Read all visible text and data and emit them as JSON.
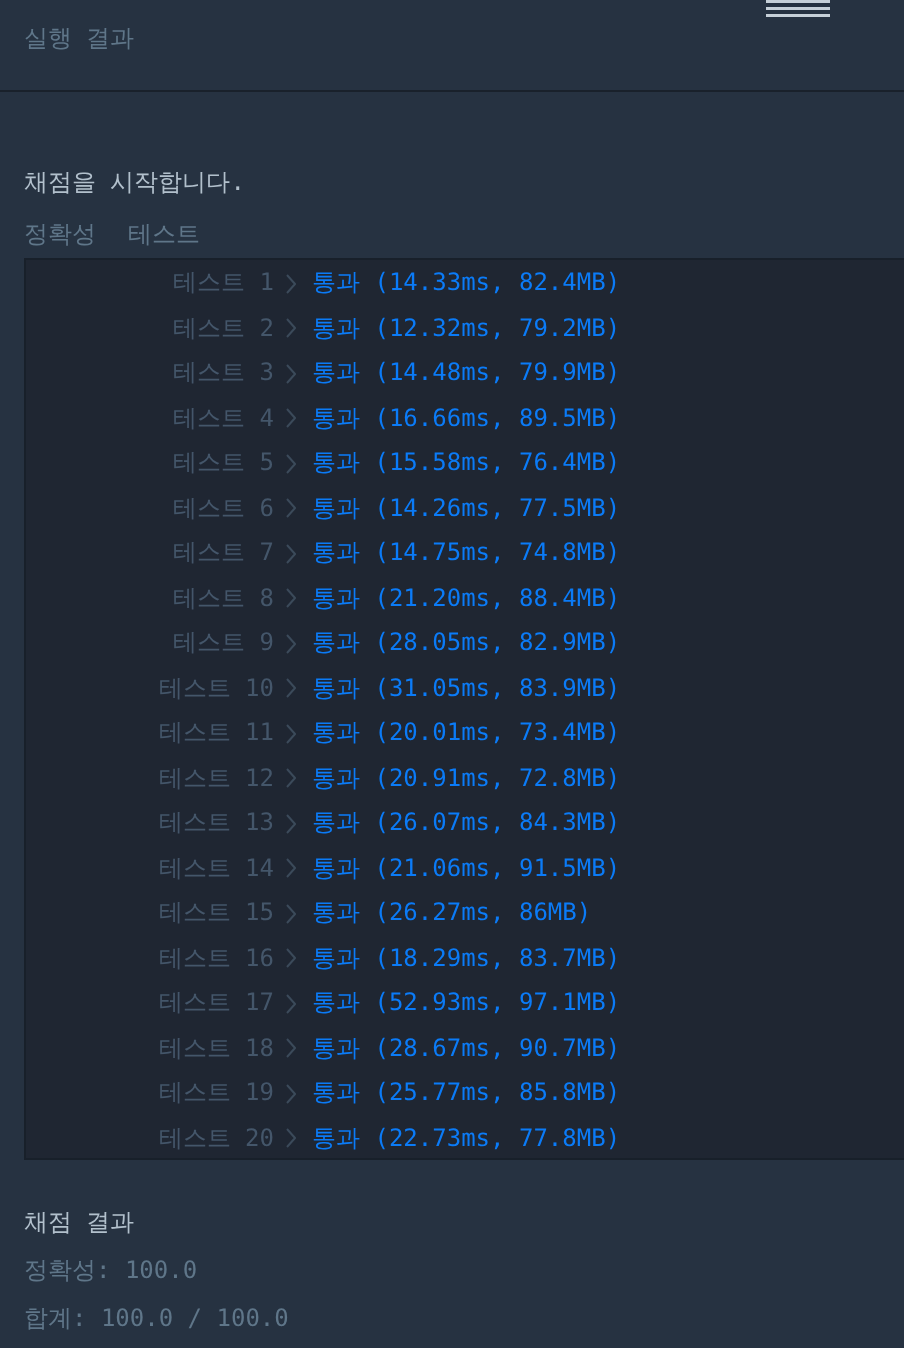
{
  "header": {
    "title": "실행 결과"
  },
  "intro": "채점을 시작합니다.",
  "tabs": [
    "정확성",
    "테스트"
  ],
  "tests": [
    {
      "label": "테스트 1",
      "result": "통과 (14.33ms, 82.4MB)"
    },
    {
      "label": "테스트 2",
      "result": "통과 (12.32ms, 79.2MB)"
    },
    {
      "label": "테스트 3",
      "result": "통과 (14.48ms, 79.9MB)"
    },
    {
      "label": "테스트 4",
      "result": "통과 (16.66ms, 89.5MB)"
    },
    {
      "label": "테스트 5",
      "result": "통과 (15.58ms, 76.4MB)"
    },
    {
      "label": "테스트 6",
      "result": "통과 (14.26ms, 77.5MB)"
    },
    {
      "label": "테스트 7",
      "result": "통과 (14.75ms, 74.8MB)"
    },
    {
      "label": "테스트 8",
      "result": "통과 (21.20ms, 88.4MB)"
    },
    {
      "label": "테스트 9",
      "result": "통과 (28.05ms, 82.9MB)"
    },
    {
      "label": "테스트 10",
      "result": "통과 (31.05ms, 83.9MB)"
    },
    {
      "label": "테스트 11",
      "result": "통과 (20.01ms, 73.4MB)"
    },
    {
      "label": "테스트 12",
      "result": "통과 (20.91ms, 72.8MB)"
    },
    {
      "label": "테스트 13",
      "result": "통과 (26.07ms, 84.3MB)"
    },
    {
      "label": "테스트 14",
      "result": "통과 (21.06ms, 91.5MB)"
    },
    {
      "label": "테스트 15",
      "result": "통과 (26.27ms, 86MB)"
    },
    {
      "label": "테스트 16",
      "result": "통과 (18.29ms, 83.7MB)"
    },
    {
      "label": "테스트 17",
      "result": "통과 (52.93ms, 97.1MB)"
    },
    {
      "label": "테스트 18",
      "result": "통과 (28.67ms, 90.7MB)"
    },
    {
      "label": "테스트 19",
      "result": "통과 (25.77ms, 85.8MB)"
    },
    {
      "label": "테스트 20",
      "result": "통과 (22.73ms, 77.8MB)"
    }
  ],
  "summary": {
    "title": "채점 결과",
    "lines": [
      "정확성: 100.0",
      "합계: 100.0 / 100.0"
    ]
  }
}
